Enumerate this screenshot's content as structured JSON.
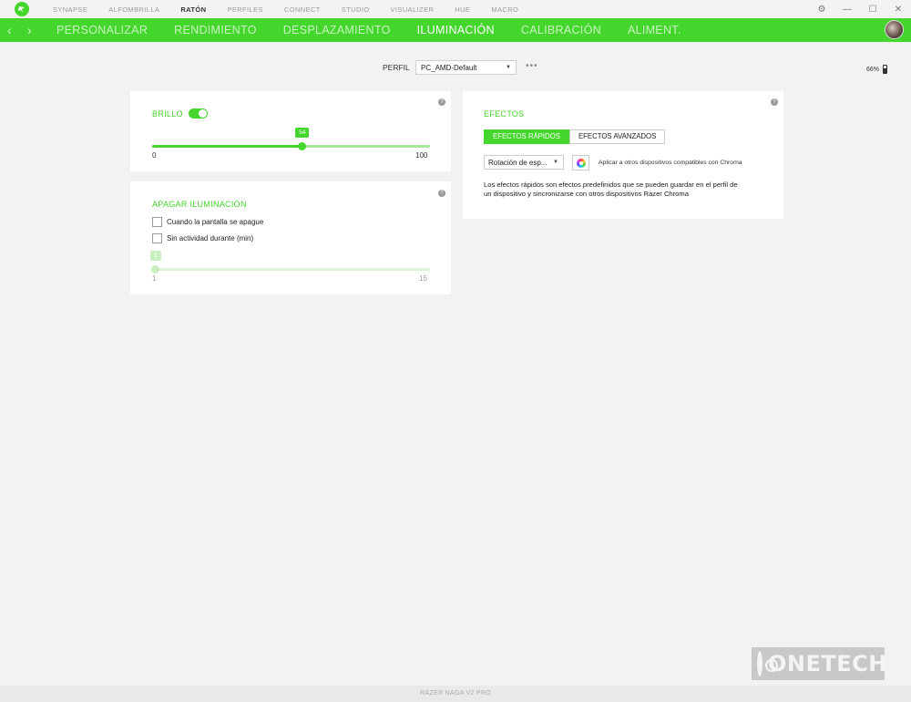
{
  "topnav": {
    "items": [
      "SYNAPSE",
      "ALFOMBRILLA",
      "RATÓN",
      "PERFILES",
      "CONNECT",
      "STUDIO",
      "VISUALIZER",
      "HUE",
      "MACRO"
    ],
    "active": "RATÓN"
  },
  "window": {
    "settings": "⚙",
    "minimize": "—",
    "maximize": "☐",
    "close": "✕"
  },
  "subnav": {
    "back": "‹",
    "forward": "›",
    "tabs": [
      "PERSONALIZAR",
      "RENDIMIENTO",
      "DESPLAZAMIENTO",
      "ILUMINACIÓN",
      "CALIBRACIÓN",
      "ALIMENT."
    ],
    "active": "ILUMINACIÓN"
  },
  "profile": {
    "label": "PERFIL",
    "value": "PC_AMD-Default",
    "more": "•••"
  },
  "battery": {
    "percent": "66%"
  },
  "brightness": {
    "title": "BRILLO",
    "enabled": true,
    "value": "54",
    "fraction": 0.54,
    "min": "0",
    "max": "100"
  },
  "lighting_off": {
    "title": "APAGAR ILUMINACIÓN",
    "option_screen": "Cuando la pantalla se apague",
    "option_idle": "Sin actividad durante (min)",
    "slider_value": "1",
    "min": "1",
    "max": "15"
  },
  "effects": {
    "title": "EFECTOS",
    "tab_quick": "EFECTOS RÁPIDOS",
    "tab_advanced": "EFECTOS AVANZADOS",
    "selected_effect": "Rotación de esp...",
    "apply_text": "Aplicar a otros dispositivos compatibles con Chroma",
    "description": "Los efectos rápidos son efectos predefinidos que se pueden guardar en el perfil de un dispositivo y sincronizarse con otros dispositivos Razer Chroma"
  },
  "help_mark": "?",
  "footer": {
    "device": "RAZER NAGA V2 PRO"
  },
  "watermark": {
    "text": "ONETECH"
  },
  "colors": {
    "accent": "#44d62c",
    "background": "#f2f2f2",
    "card": "#ffffff"
  }
}
